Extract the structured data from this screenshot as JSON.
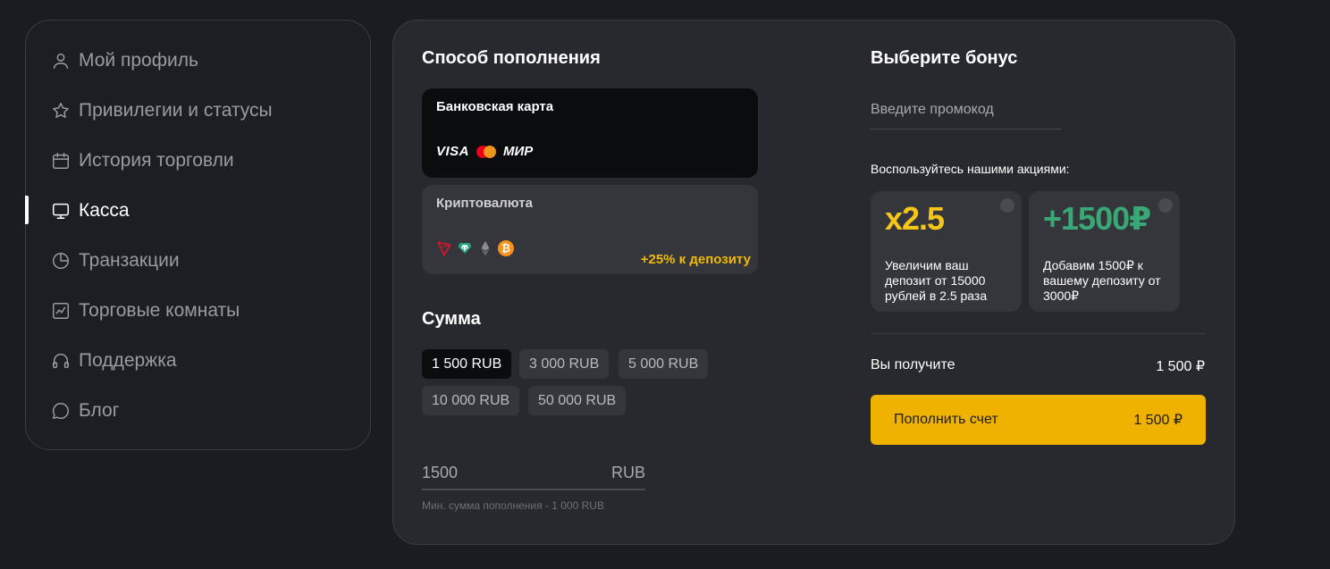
{
  "sidebar": {
    "items": [
      {
        "label": "Мой профиль",
        "icon": "user-icon"
      },
      {
        "label": "Привилегии и статусы",
        "icon": "star-icon"
      },
      {
        "label": "История торговли",
        "icon": "calendar-icon"
      },
      {
        "label": "Касса",
        "icon": "monitor-icon",
        "active": true
      },
      {
        "label": "Транзакции",
        "icon": "pie-chart-icon"
      },
      {
        "label": "Торговые комнаты",
        "icon": "chart-line-icon"
      },
      {
        "label": "Поддержка",
        "icon": "headphones-icon"
      },
      {
        "label": "Блог",
        "icon": "chat-bubble-icon"
      }
    ]
  },
  "deposit": {
    "method_title": "Способ пополнения",
    "methods": [
      {
        "label": "Банковская карта",
        "logos": [
          "VISA",
          "МИР"
        ]
      },
      {
        "label": "Криптовалюта",
        "bonus": "+25% к депозиту"
      }
    ],
    "amount_title": "Сумма",
    "chips": [
      "1 500 RUB",
      "3 000 RUB",
      "5 000 RUB",
      "10 000 RUB",
      "50 000 RUB"
    ],
    "amount_value": "1500",
    "currency": "RUB",
    "min_note": "Мин. сумма пополнения - 1 000 RUB"
  },
  "bonus": {
    "title": "Выберите бонус",
    "promo_placeholder": "Введите промокод",
    "promo_label": "Воспользуйтесь нашими акциями:",
    "cards": [
      {
        "big": "x2.5",
        "desc": "Увеличим ваш депозит от 15000 рублей в 2.5 раза",
        "color": "#f5c518"
      },
      {
        "big": "+1500₽",
        "desc": "Добавим 1500₽ к вашему депозиту от 3000₽",
        "color": "#3aa876"
      }
    ],
    "receive_label": "Вы получите",
    "receive_value": "1 500 ₽",
    "button_label": "Пополнить счет",
    "button_value": "1 500 ₽"
  },
  "colors": {
    "accent": "#f0b200",
    "background": "#1b1c21",
    "panel": "#28292e"
  }
}
